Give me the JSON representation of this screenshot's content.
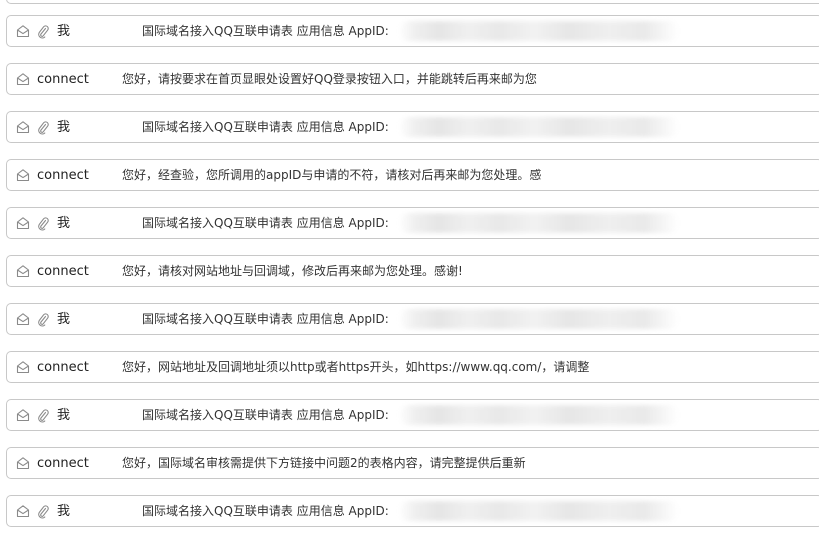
{
  "messages": [
    {
      "sender": "我",
      "subject": "国际域名接入QQ互联申请表 应用信息 AppID:",
      "attachment": true,
      "redacted_id": true
    },
    {
      "sender": "connect",
      "subject": "您好，请按要求在首页显眼处设置好QQ登录按钮入口，并能跳转后再来邮为您",
      "attachment": false,
      "redacted_id": false
    },
    {
      "sender": "我",
      "subject": "国际域名接入QQ互联申请表 应用信息 AppID:",
      "attachment": true,
      "redacted_id": true
    },
    {
      "sender": "connect",
      "subject": "您好，经查验，您所调用的appID与申请的不符，请核对后再来邮为您处理。感",
      "attachment": false,
      "redacted_id": false
    },
    {
      "sender": "我",
      "subject": "国际域名接入QQ互联申请表 应用信息 AppID:",
      "attachment": true,
      "redacted_id": true
    },
    {
      "sender": "connect",
      "subject": "您好，请核对网站地址与回调域，修改后再来邮为您处理。感谢!",
      "attachment": false,
      "redacted_id": false
    },
    {
      "sender": "我",
      "subject": "国际域名接入QQ互联申请表 应用信息 AppID:",
      "attachment": true,
      "redacted_id": true
    },
    {
      "sender": "connect",
      "subject": "您好，网站地址及回调地址须以http或者https开头，如https://www.qq.com/，请调整",
      "attachment": false,
      "redacted_id": false
    },
    {
      "sender": "我",
      "subject": "国际域名接入QQ互联申请表 应用信息 AppID:",
      "attachment": true,
      "redacted_id": true
    },
    {
      "sender": "connect",
      "subject": "您好，国际域名审核需提供下方链接中问题2的表格内容，请完整提供后重新",
      "attachment": false,
      "redacted_id": false
    },
    {
      "sender": "我",
      "subject": "国际域名接入QQ互联申请表 应用信息 AppID:",
      "attachment": true,
      "redacted_id": true
    }
  ],
  "icons": {
    "mail": "envelope-icon",
    "attachment": "paperclip-icon"
  },
  "colors": {
    "border": "#c8c8c8",
    "icon": "#8a8a8a",
    "text": "#222222"
  }
}
